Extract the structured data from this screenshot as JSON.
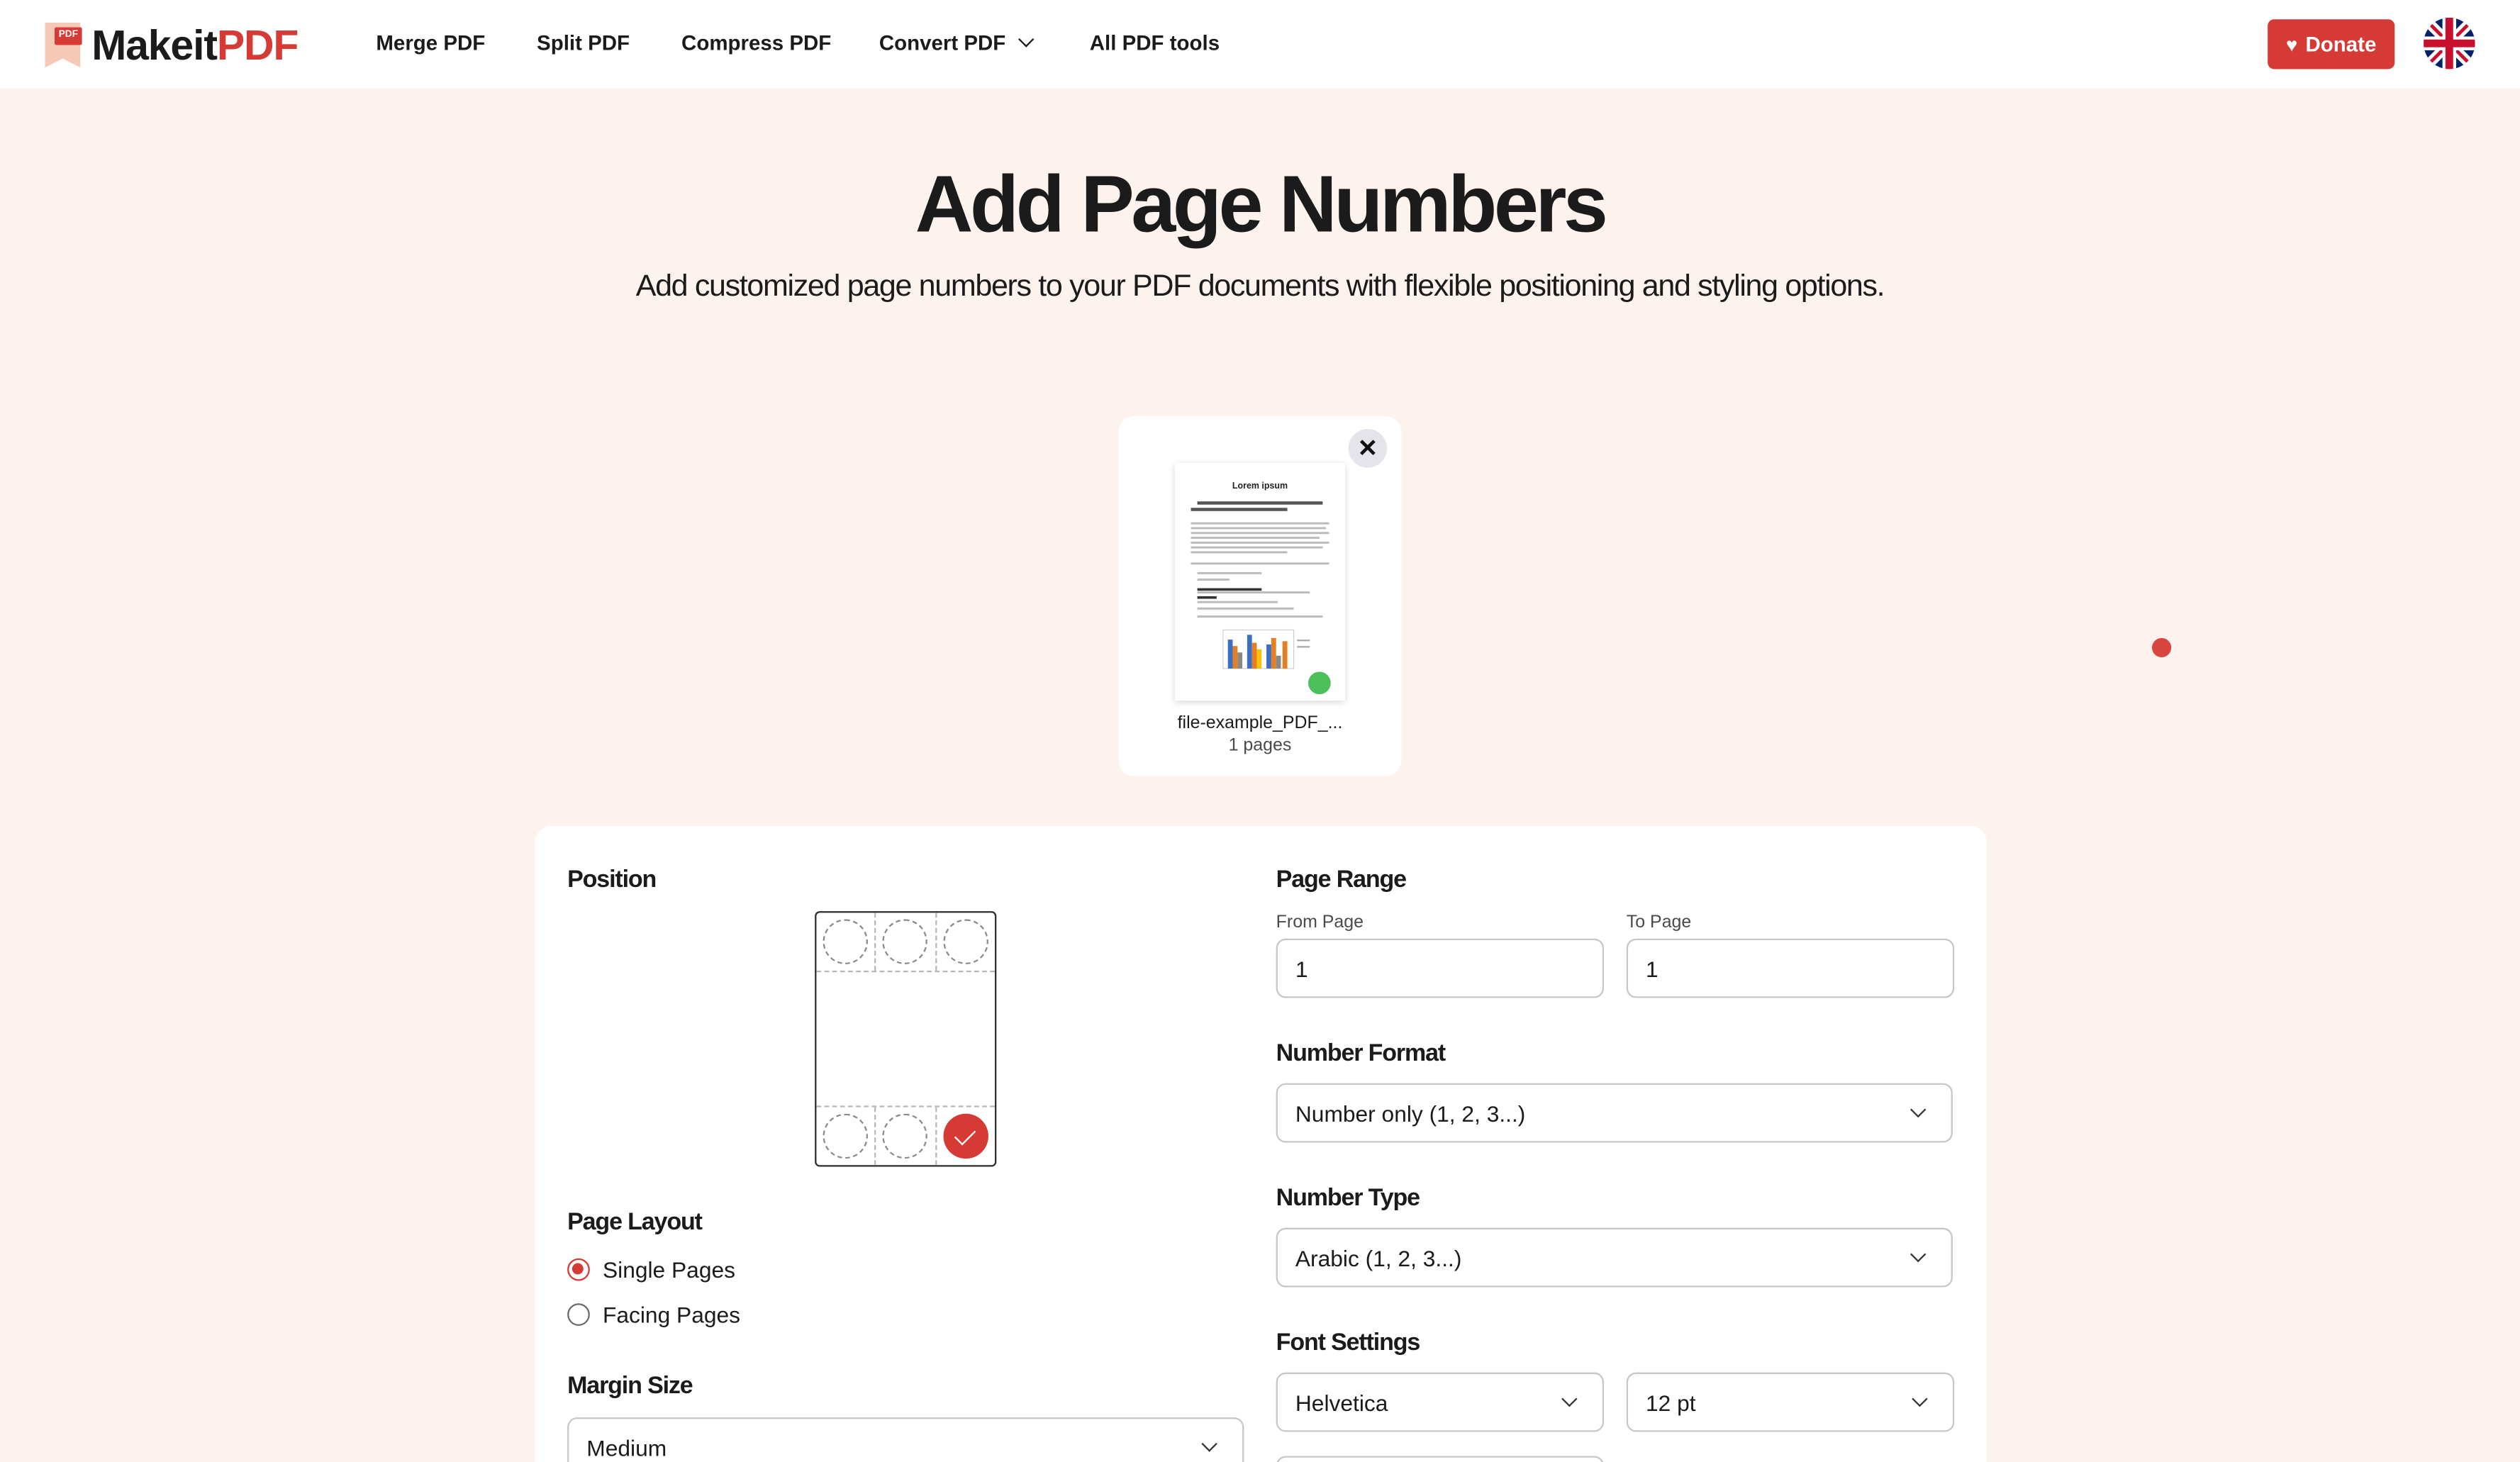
{
  "header": {
    "logo": {
      "part1": "Makeit",
      "part2": "PDF",
      "badge": "PDF"
    },
    "nav": [
      "Merge PDF",
      "Split PDF",
      "Compress PDF",
      "Convert PDF",
      "All PDF tools"
    ],
    "donate_label": "Donate",
    "language_icon": "uk-flag-icon"
  },
  "hero": {
    "title": "Add Page Numbers",
    "subtitle": "Add customized page numbers to your PDF documents with flexible positioning and styling options."
  },
  "file": {
    "name": "file-example_PDF_...",
    "pages": "1 pages",
    "thumb_title": "Lorem ipsum",
    "remove_icon": "close-icon",
    "status_color": "#4cbf5a"
  },
  "settings": {
    "position": {
      "label": "Position",
      "selected": "bottom-right"
    },
    "page_layout": {
      "label": "Page Layout",
      "options": [
        "Single Pages",
        "Facing Pages"
      ],
      "selected": "Single Pages"
    },
    "margin_size": {
      "label": "Margin Size",
      "value": "Medium"
    },
    "page_range": {
      "label": "Page Range",
      "from_label": "From Page",
      "from_value": "1",
      "to_label": "To Page",
      "to_value": "1"
    },
    "number_format": {
      "label": "Number Format",
      "value": "Number only (1, 2, 3...)"
    },
    "number_type": {
      "label": "Number Type",
      "value": "Arabic (1, 2, 3...)"
    },
    "font_settings": {
      "label": "Font Settings",
      "font": "Helvetica",
      "size": "12 pt"
    }
  },
  "colors": {
    "accent": "#d63a35",
    "background": "#fcf3ee"
  }
}
